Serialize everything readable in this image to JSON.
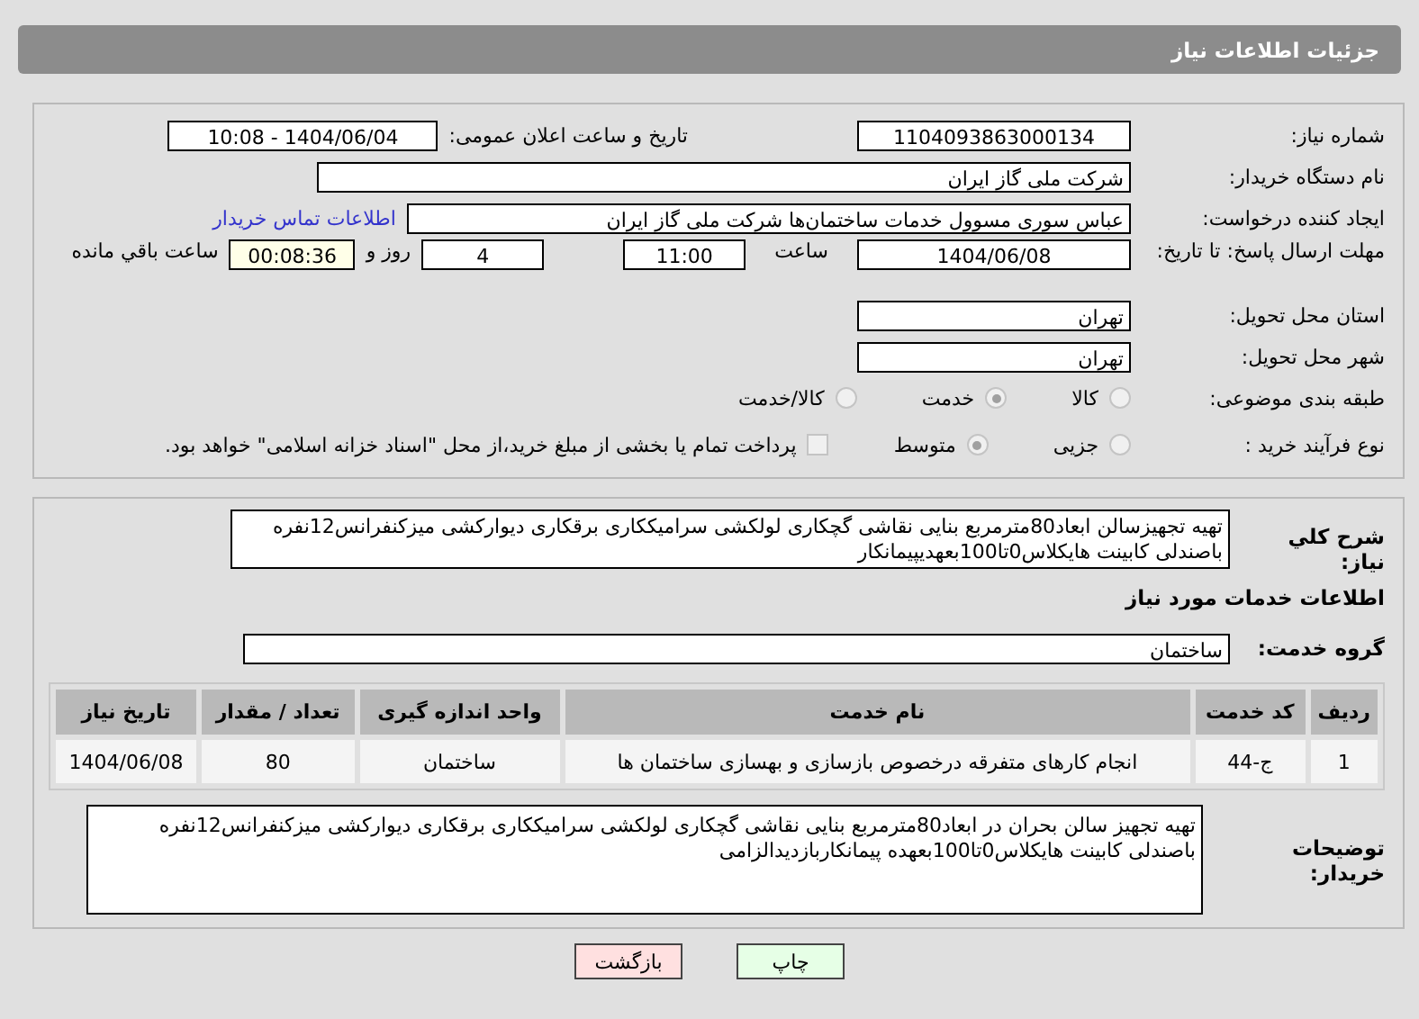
{
  "header": {
    "title": "جزئیات اطلاعات نیاز"
  },
  "details": {
    "need_number": {
      "label": "شماره نیاز:",
      "value": "1104093863000134"
    },
    "announce": {
      "label": "تاریخ و ساعت اعلان عمومی:",
      "value": "1404/06/04 - 10:08"
    },
    "buyer": {
      "label": "نام دستگاه خریدار:",
      "value": "شرکت ملی گاز ایران"
    },
    "creator": {
      "label": "ایجاد کننده درخواست:",
      "value": "عباس سوری مسوول خدمات ساختمان‌ها  شرکت ملی گاز ایران",
      "link": "اطلاعات تماس خریدار"
    },
    "deadline": {
      "label": "مهلت ارسال پاسخ: تا تاریخ:",
      "date": "1404/06/08",
      "time_label": "ساعت",
      "time": "11:00",
      "days": "4",
      "days_label": "روز و",
      "remaining": "00:08:36",
      "remaining_label": "ساعت باقي مانده"
    },
    "province": {
      "label": "استان محل تحویل:",
      "value": "تهران"
    },
    "city": {
      "label": "شهر محل تحویل:",
      "value": "تهران"
    },
    "category": {
      "label": "طبقه بندی موضوعی:",
      "options": [
        {
          "label": "کالا",
          "selected": false
        },
        {
          "label": "خدمت",
          "selected": true
        },
        {
          "label": "کالا/خدمت",
          "selected": false
        }
      ]
    },
    "process": {
      "label": "نوع فرآیند خرید :",
      "options": [
        {
          "label": "جزیی",
          "selected": false
        },
        {
          "label": "متوسط",
          "selected": true
        }
      ],
      "payment": {
        "checked": false,
        "label": "پرداخت تمام یا بخشی از مبلغ خرید،از محل \"اسناد خزانه اسلامی\" خواهد بود."
      }
    }
  },
  "need": {
    "summary_label": "شرح کلي نياز:",
    "summary": "تهیه تجهیزسالن ابعاد80مترمربع بنایی نقاشی گچکاری لولکشی سرامیککاری برقکاری دیوارکشی میزکنفرانس12نفره باصندلی کابینت هایکلاس0تا100بعهدیپیمانکار",
    "services_title": "اطلاعات خدمات مورد نیاز",
    "group_label": "گروه خدمت:",
    "group": "ساختمان",
    "table": {
      "columns": [
        "ردیف",
        "کد خدمت",
        "نام خدمت",
        "واحد اندازه گیری",
        "تعداد / مقدار",
        "تاریخ نیاز"
      ],
      "rows": [
        [
          "1",
          "ج-44",
          "انجام کارهای متفرقه درخصوص بازسازی و بهسازی ساختمان ها",
          "ساختمان",
          "80",
          "1404/06/08"
        ]
      ]
    },
    "notes_label": "توضیحات خریدار:",
    "notes": "تهیه تجهیز سالن بحران در ابعاد80مترمربع بنایی نقاشی گچکاری لولکشی سرامیککاری برقکاری دیوارکشی میزکنفرانس12نفره باصندلی کابینت هایکلاس0تا100بعهده پیمانکاربازدیدالزامی"
  },
  "buttons": {
    "print": "چاپ",
    "back": "بازگشت"
  }
}
